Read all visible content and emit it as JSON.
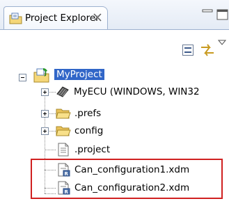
{
  "view": {
    "title": "Project Explorer",
    "icons": {
      "view": "project-explorer-folder-icon",
      "close": "close-x-icon",
      "minimize": "minimize-icon",
      "maximize": "maximize-icon"
    }
  },
  "toolbar": {
    "icons": [
      "collapse-all-icon",
      "link-with-editor-icon",
      "view-menu-icon"
    ]
  },
  "tree": {
    "project": {
      "label": "MyProject",
      "expanded": true,
      "selected": true
    },
    "items": [
      {
        "label": "MyECU (WINDOWS, WIN32",
        "icon": "ecu-icon",
        "expandable": true
      },
      {
        "label": ".prefs",
        "icon": "folder-icon",
        "expandable": true
      },
      {
        "label": "config",
        "icon": "folder-icon",
        "expandable": true
      },
      {
        "label": ".project",
        "icon": "file-icon",
        "expandable": false
      },
      {
        "label": "Can_configuration1.xdm",
        "icon": "xdm-file-icon",
        "expandable": false
      },
      {
        "label": "Can_configuration2.xdm",
        "icon": "xdm-file-icon",
        "expandable": false
      }
    ]
  },
  "colors": {
    "selection": "#3166c8",
    "highlight_box": "#d02020",
    "border": "#9db1cf"
  }
}
